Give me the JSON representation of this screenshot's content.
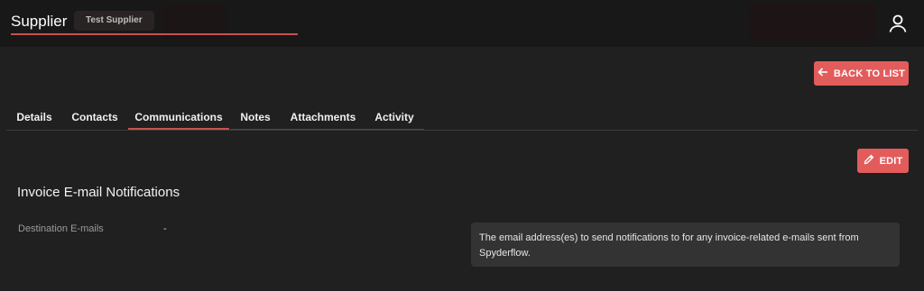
{
  "header": {
    "title": "Supplier",
    "chip_label": "Test Supplier",
    "user_icon": "user-icon"
  },
  "actions": {
    "back_label": "BACK TO LIST",
    "back_icon": "arrow-left-icon",
    "edit_label": "EDIT",
    "edit_icon": "pencil-icon"
  },
  "tabs": [
    {
      "label": "Details"
    },
    {
      "label": "Contacts"
    },
    {
      "label": "Communications",
      "active": true
    },
    {
      "label": "Notes"
    },
    {
      "label": "Attachments"
    },
    {
      "label": "Activity"
    }
  ],
  "section": {
    "title": "Invoice E-mail Notifications",
    "fields": [
      {
        "label": "Destination E-mails",
        "value": "-",
        "help": "The email address(es) to send notifications to for any invoice-related e-mails sent from Spyderflow."
      }
    ]
  },
  "colors": {
    "accent": "#e35c5c",
    "underline": "#c9504f",
    "background": "#202020",
    "topbar": "#181818"
  }
}
